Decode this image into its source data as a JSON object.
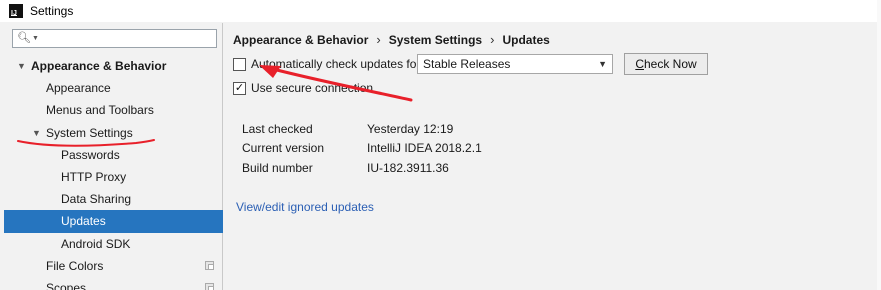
{
  "window": {
    "title": "Settings",
    "app_icon": "intellij-icon",
    "app_icon_letters": "IJ"
  },
  "sidebar": {
    "search": {
      "placeholder": "",
      "value": "",
      "icon": "search-icon"
    },
    "items": [
      {
        "label": "Appearance & Behavior",
        "level": 0,
        "expanded": true,
        "bold": true
      },
      {
        "label": "Appearance",
        "level": 1
      },
      {
        "label": "Menus and Toolbars",
        "level": 1
      },
      {
        "label": "System Settings",
        "level": 1,
        "expanded": true
      },
      {
        "label": "Passwords",
        "level": 2
      },
      {
        "label": "HTTP Proxy",
        "level": 2
      },
      {
        "label": "Data Sharing",
        "level": 2
      },
      {
        "label": "Updates",
        "level": 2,
        "selected": true
      },
      {
        "label": "Android SDK",
        "level": 2
      },
      {
        "label": "File Colors",
        "level": 1,
        "icon": "copy-icon"
      },
      {
        "label": "Scopes",
        "level": 1,
        "icon": "copy-icon"
      }
    ]
  },
  "breadcrumb": [
    "Appearance & Behavior",
    "System Settings",
    "Updates"
  ],
  "updates": {
    "auto_check": {
      "label": "Automatically check updates for",
      "checked": false
    },
    "channel": {
      "value": "Stable Releases"
    },
    "check_now": {
      "label_mnemonic": "C",
      "label_rest": "heck Now"
    },
    "secure_connection": {
      "label": "Use secure connection",
      "checked": true
    },
    "info": [
      {
        "label": "Last checked",
        "value": "Yesterday 12:19"
      },
      {
        "label": "Current version",
        "value": "IntelliJ IDEA 2018.2.1"
      },
      {
        "label": "Build number",
        "value": "IU-182.3911.36"
      }
    ],
    "ignored_link": "View/edit ignored updates"
  },
  "colors": {
    "selection": "#2675bf",
    "annotation_red": "#e8202a",
    "link": "#2b5fb4",
    "background": "#f2f2f2"
  }
}
